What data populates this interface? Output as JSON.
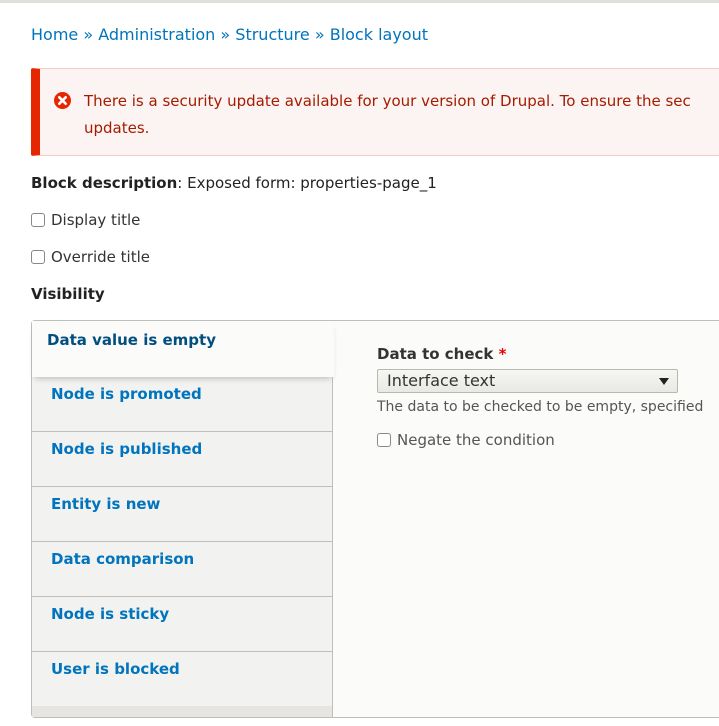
{
  "breadcrumb": {
    "items": [
      "Home",
      "Administration",
      "Structure",
      "Block layout"
    ],
    "separator": "»"
  },
  "alert": {
    "type": "error",
    "icon": "error-circle-x-icon",
    "line1": "There is a security update available for your version of Drupal. To ensure the sec",
    "line2": "updates."
  },
  "block_description": {
    "label": "Block description",
    "value": ": Exposed form: properties-page_1"
  },
  "checkboxes": {
    "display_title": {
      "label": "Display title",
      "checked": false
    },
    "override_title": {
      "label": "Override title",
      "checked": false
    }
  },
  "visibility": {
    "heading": "Visibility",
    "tabs": [
      {
        "label": "Data value is empty",
        "selected": true
      },
      {
        "label": "Node is promoted",
        "selected": false
      },
      {
        "label": "Node is published",
        "selected": false
      },
      {
        "label": "Entity is new",
        "selected": false
      },
      {
        "label": "Data comparison",
        "selected": false
      },
      {
        "label": "Node is sticky",
        "selected": false
      },
      {
        "label": "User is blocked",
        "selected": false
      }
    ],
    "pane": {
      "field_label": "Data to check",
      "required_marker": "*",
      "select_value": "Interface text",
      "description": "The data to be checked to be empty, specified",
      "negate_label": "Negate the condition",
      "negate_checked": false
    }
  },
  "colors": {
    "link": "#0074bd",
    "error_border": "#e62600",
    "error_text": "#a51b00",
    "error_bg": "#fcf4f2"
  }
}
